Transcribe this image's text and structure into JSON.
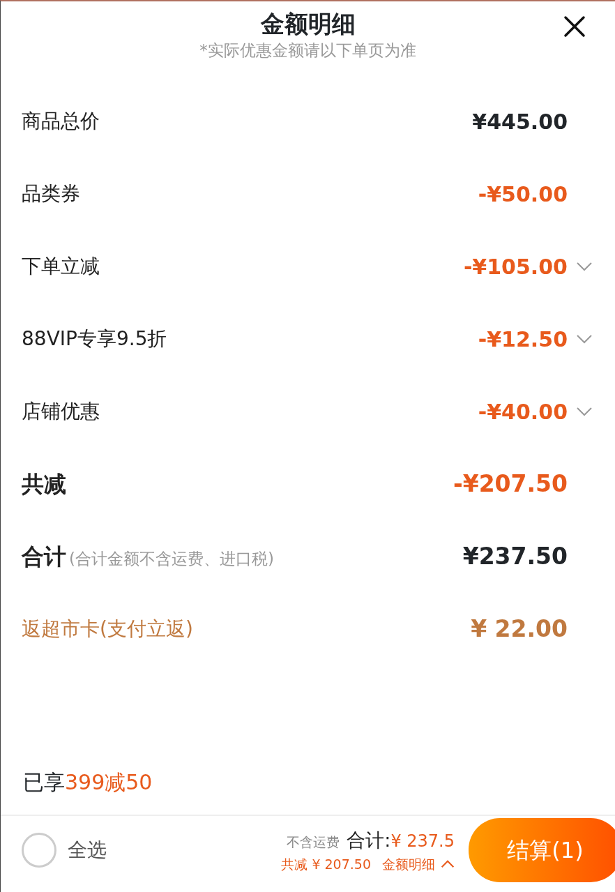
{
  "header": {
    "title": "金额明细",
    "subtitle": "*实际优惠金额请以下单页为准"
  },
  "rows": [
    {
      "kind": "price",
      "label": "商品总价",
      "value": "¥445.00",
      "expandable": false
    },
    {
      "kind": "discount",
      "label": "品类券",
      "value": "-¥50.00",
      "expandable": false
    },
    {
      "kind": "discount",
      "label": "下单立减",
      "value": "-¥105.00",
      "expandable": true
    },
    {
      "kind": "discount",
      "label": "88VIP专享9.5折",
      "value": "-¥12.50",
      "expandable": true
    },
    {
      "kind": "discount",
      "label": "店铺优惠",
      "value": "-¥40.00",
      "expandable": true
    },
    {
      "kind": "total_discount",
      "label": "共减",
      "value": "-¥207.50",
      "expandable": false
    },
    {
      "kind": "total",
      "label": "合计",
      "note": "(合计金额不含运费、进口税)",
      "value": "¥237.50",
      "expandable": false
    },
    {
      "kind": "rebate",
      "label": "返超市卡(支付立返)",
      "value": "¥ 22.00",
      "expandable": false
    }
  ],
  "promo": {
    "prefix": "已享",
    "highlight": "399减50"
  },
  "footer": {
    "select_all": {
      "label": "全选",
      "checked": false
    },
    "shipping_note": "不含运费",
    "total_label": "合计:",
    "total_value": "¥ 237.5",
    "discount_text": "共减 ¥ 207.50",
    "details_link": "金额明细",
    "details_expanded": true,
    "checkout": "结算(1)"
  }
}
